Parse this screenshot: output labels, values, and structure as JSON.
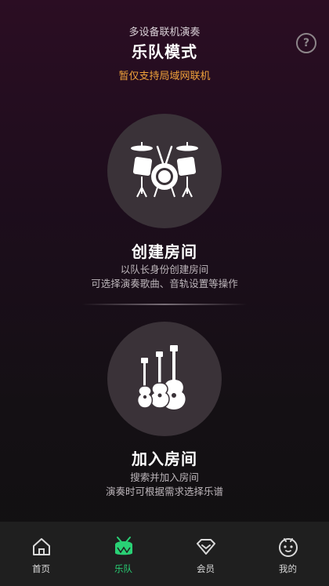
{
  "header": {
    "subtitle": "多设备联机演奏",
    "title": "乐队模式",
    "notice": "暂仅支持局域网联机",
    "help_glyph": "?"
  },
  "create_room": {
    "icon": "drum-kit-icon",
    "title": "创建房间",
    "desc_line1": "以队长身份创建房间",
    "desc_line2": "可选择演奏歌曲、音轨设置等操作"
  },
  "join_room": {
    "icon": "guitars-icon",
    "title": "加入房间",
    "desc_line1": "搜索并加入房间",
    "desc_line2": "演奏时可根据需求选择乐谱"
  },
  "tabbar": {
    "tabs": [
      {
        "label": "首页",
        "icon": "home-icon",
        "active": false
      },
      {
        "label": "乐队",
        "icon": "drum-icon",
        "active": true
      },
      {
        "label": "会员",
        "icon": "diamond-icon",
        "active": false
      },
      {
        "label": "我的",
        "icon": "profile-face-icon",
        "active": false
      }
    ]
  },
  "colors": {
    "accent_green": "#29d175",
    "notice_orange": "#f0a23a",
    "circle_bg": "#3a3238"
  }
}
